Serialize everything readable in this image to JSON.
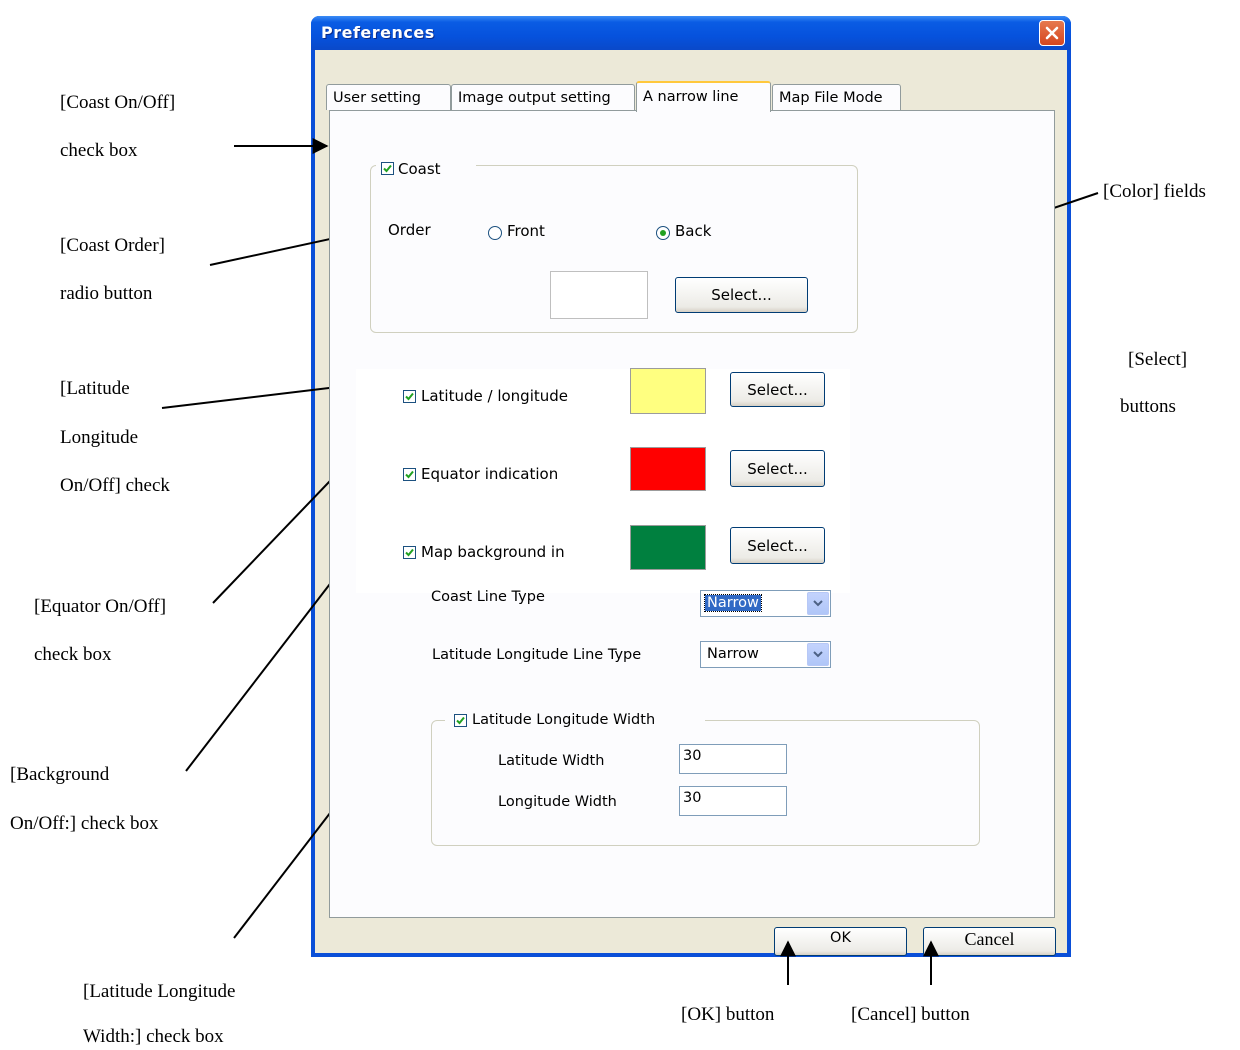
{
  "dialog": {
    "title": "Preferences",
    "tabs": [
      "User setting",
      "Image output setting",
      "A narrow line",
      "Map File Mode"
    ],
    "active_tab": "A narrow line"
  },
  "coast": {
    "label": "Coast",
    "checked": true,
    "order_label": "Order",
    "front_label": "Front",
    "back_label": "Back",
    "selected_order": "Back",
    "select_label": "Select..."
  },
  "layers": [
    {
      "label": "Latitude / longitude",
      "checked": true,
      "color": "#ffff80",
      "select_label": "Select..."
    },
    {
      "label": "Equator indication",
      "checked": true,
      "color": "#ff0000",
      "select_label": "Select..."
    },
    {
      "label": "Map background in",
      "checked": true,
      "color": "#00803f",
      "select_label": "Select..."
    }
  ],
  "line_types": {
    "coast_label": "Coast Line Type",
    "coast_value": "Narrow",
    "latlon_label": "Latitude Longitude Line Type",
    "latlon_value": "Narrow"
  },
  "width_group": {
    "label": "Latitude Longitude Width",
    "checked": true,
    "lat_label": "Latitude Width",
    "lat_value": "30",
    "lon_label": "Longitude Width",
    "lon_value": "30"
  },
  "buttons": {
    "ok": "OK",
    "cancel": "Cancel"
  },
  "annotations": {
    "coast_onoff": [
      "[Coast On/Off]",
      "check box"
    ],
    "coast_order": [
      "[Coast Order]",
      "radio button"
    ],
    "latlon_onoff": [
      "[Latitude",
      "Longitude",
      "On/Off]   check"
    ],
    "equator_onoff": [
      "[Equator On/Off]",
      "check box"
    ],
    "background_onoff": [
      "[Background",
      "On/Off:] check box"
    ],
    "width_onoff": [
      "[Latitude Longitude",
      "Width:] check box"
    ],
    "color_fields": "[Color] fields",
    "select_buttons": [
      "[Select]",
      "buttons"
    ],
    "ok_button": "[OK] button",
    "cancel_button": "[Cancel] button"
  }
}
